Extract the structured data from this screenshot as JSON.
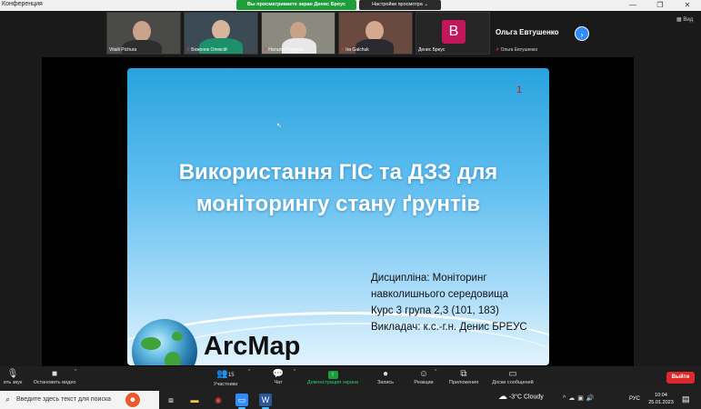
{
  "window": {
    "title": "Конференция",
    "controls": [
      "—",
      "❐",
      "✕"
    ]
  },
  "banner": {
    "share_notice": "Вы просматриваете экран Денис Бреус",
    "view_options": "Настройки просмотра",
    "view_options_caret": "⌄"
  },
  "participants": [
    {
      "name": "Vitalii Pichura",
      "muted": false
    },
    {
      "name": "Божонок Олексій",
      "muted": true
    },
    {
      "name": "Наталія Горнова",
      "muted": true
    },
    {
      "name": "Ira Galchuk",
      "muted": true
    },
    {
      "name": "Денис Бреус",
      "muted": false,
      "avatar_letter": "B",
      "avatar_color": "#c2185b"
    }
  ],
  "active_speaker": {
    "name": "Ольга Евтушенко",
    "label": "Ольга Евтушенко"
  },
  "strip_controls": {
    "next_icon": "›",
    "view_label": "Вид"
  },
  "slide": {
    "number": "1",
    "title_line1": "Використання ГІС та ДЗЗ для",
    "title_line2": "моніторингу стану ґрунтів",
    "discipline_line1": "Дисципліна: Моніторинг",
    "discipline_line2": "навколишнього середовища",
    "course": "Курс 3 група 2,3 (101, 183)",
    "lecturer": "Викладач: к.с.-г.н. Денис БРЕУС",
    "logo_text": "ArcMap"
  },
  "toolbar": {
    "unmute_label": "ить звук",
    "video_label": "Остановить видео",
    "participants_label": "Участники",
    "participants_count": "15",
    "chat_label": "Чат",
    "share_label": "Демонстрация экрана",
    "record_label": "Запись",
    "reactions_label": "Реакции",
    "apps_label": "Приложения",
    "whiteboard_label": "Доски сообщений",
    "leave_label": "Выйти"
  },
  "taskbar": {
    "search_placeholder": "Введите здесь текст для поиска",
    "weather": "-3°C  Cloudy",
    "language": "РУС",
    "time": "10:04",
    "date": "25.01.2023"
  },
  "colors": {
    "share_green": "#1f9d3a",
    "leave_red": "#e02828",
    "zoom_blue": "#2d8cff",
    "slide_top": "#29a3de"
  }
}
